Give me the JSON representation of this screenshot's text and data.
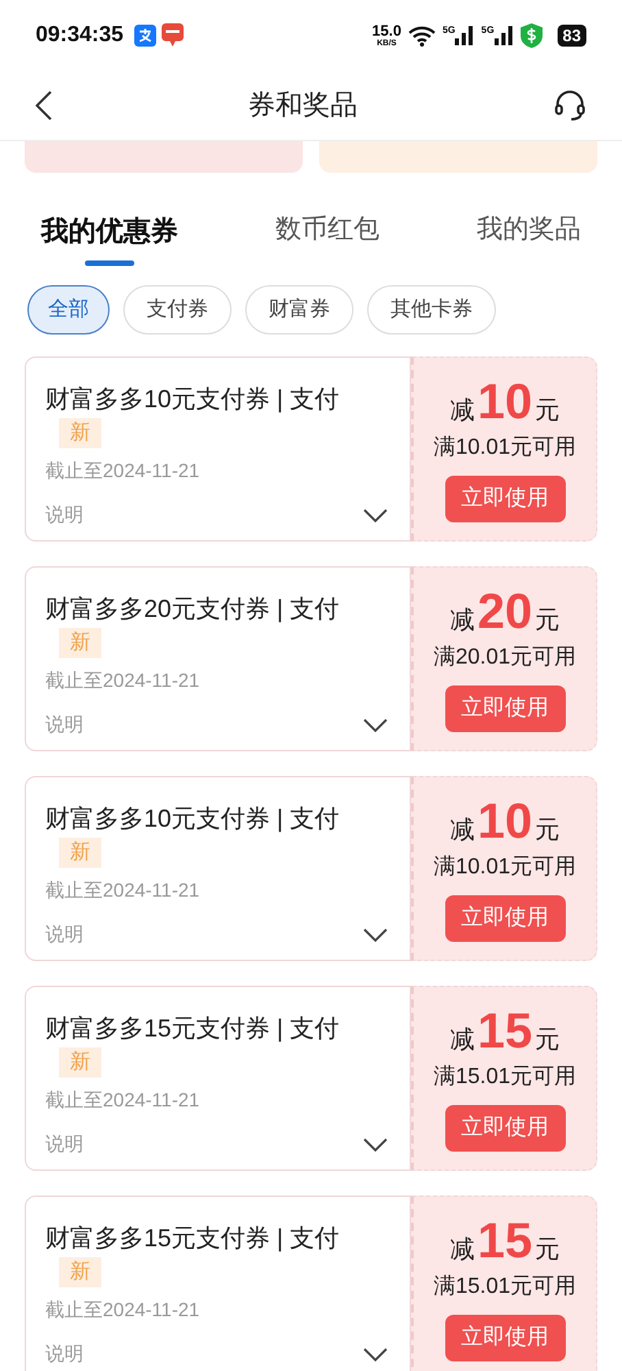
{
  "status_bar": {
    "time": "09:34:35",
    "speed": "15.0",
    "speed_unit": "KB/S",
    "networks": [
      "5G",
      "5G"
    ],
    "battery": "83"
  },
  "header": {
    "title": "券和奖品"
  },
  "tabs": [
    {
      "label": "我的优惠券",
      "selected": true
    },
    {
      "label": "数币红包",
      "selected": false
    },
    {
      "label": "我的奖品",
      "selected": false
    }
  ],
  "filters": [
    {
      "label": "全部",
      "selected": true
    },
    {
      "label": "支付券",
      "selected": false
    },
    {
      "label": "财富券",
      "selected": false
    },
    {
      "label": "其他卡券",
      "selected": false
    }
  ],
  "coupons": [
    {
      "title": "财富多多10元支付券 | 支付",
      "tag": "新",
      "expiry": "截止至2024-11-21",
      "note": "说明",
      "prefix": "减",
      "amount": "10",
      "unit": "元",
      "condition": "满10.01元可用",
      "button": "立即使用"
    },
    {
      "title": "财富多多20元支付券 | 支付",
      "tag": "新",
      "expiry": "截止至2024-11-21",
      "note": "说明",
      "prefix": "减",
      "amount": "20",
      "unit": "元",
      "condition": "满20.01元可用",
      "button": "立即使用"
    },
    {
      "title": "财富多多10元支付券 | 支付",
      "tag": "新",
      "expiry": "截止至2024-11-21",
      "note": "说明",
      "prefix": "减",
      "amount": "10",
      "unit": "元",
      "condition": "满10.01元可用",
      "button": "立即使用"
    },
    {
      "title": "财富多多15元支付券 | 支付",
      "tag": "新",
      "expiry": "截止至2024-11-21",
      "note": "说明",
      "prefix": "减",
      "amount": "15",
      "unit": "元",
      "condition": "满15.01元可用",
      "button": "立即使用"
    },
    {
      "title": "财富多多15元支付券 | 支付",
      "tag": "新",
      "expiry": "截止至2024-11-21",
      "note": "说明",
      "prefix": "减",
      "amount": "15",
      "unit": "元",
      "condition": "满15.01元可用",
      "button": "立即使用"
    }
  ]
}
